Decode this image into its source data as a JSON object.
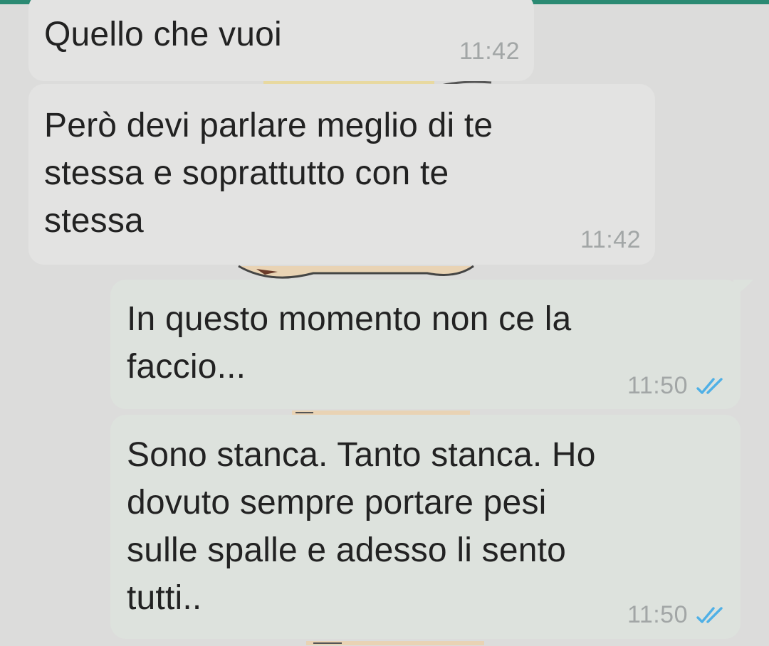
{
  "theme": {
    "accent": "#2b8a73",
    "background": "#dcdcdb",
    "incoming_bubble": "#e3e3e2",
    "outgoing_bubble": "#dde2dd",
    "read_tick": "#4fb0e6"
  },
  "messages": [
    {
      "direction": "incoming",
      "text": "Quello che vuoi",
      "time": "11:42"
    },
    {
      "direction": "incoming",
      "text": "Però devi parlare meglio di te\nstessa e soprattutto con te\nstessa",
      "time": "11:42"
    },
    {
      "direction": "outgoing",
      "text": "In questo momento non ce la\nfaccio...",
      "time": "11:50",
      "status_icon": "double-check-read-icon"
    },
    {
      "direction": "outgoing",
      "text": "Sono stanca. Tanto stanca. Ho\ndovuto sempre portare pesi\nsulle spalle e adesso li sento\ntutti..",
      "time": "11:50",
      "status_icon": "double-check-read-icon"
    }
  ]
}
